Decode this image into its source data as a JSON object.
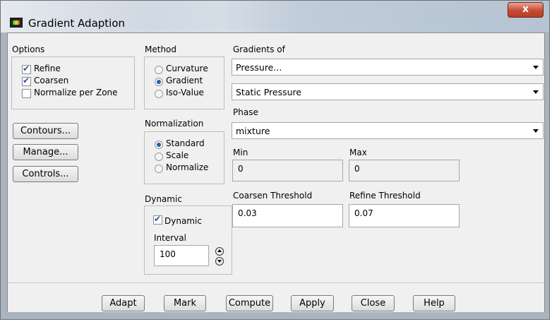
{
  "window": {
    "title": "Gradient Adaption",
    "close_glyph": "x"
  },
  "options": {
    "heading": "Options",
    "refine": {
      "label": "Refine",
      "checked": true
    },
    "coarsen": {
      "label": "Coarsen",
      "checked": true
    },
    "normalize_per_zone": {
      "label": "Normalize per Zone",
      "checked": false
    }
  },
  "side_buttons": {
    "contours": "Contours...",
    "manage": "Manage...",
    "controls": "Controls..."
  },
  "method": {
    "heading": "Method",
    "options": [
      "Curvature",
      "Gradient",
      "Iso-Value"
    ],
    "selected": "Gradient"
  },
  "normalization": {
    "heading": "Normalization",
    "options": [
      "Standard",
      "Scale",
      "Normalize"
    ],
    "selected": "Standard"
  },
  "dynamic": {
    "heading": "Dynamic",
    "checkbox_label": "Dynamic",
    "checked": true,
    "interval_label": "Interval",
    "interval_value": "100"
  },
  "gradients_of": {
    "heading": "Gradients of",
    "category": "Pressure...",
    "quantity": "Static Pressure"
  },
  "phase": {
    "heading": "Phase",
    "value": "mixture"
  },
  "range": {
    "min_label": "Min",
    "min_value": "0",
    "max_label": "Max",
    "max_value": "0"
  },
  "thresholds": {
    "coarsen_label": "Coarsen Threshold",
    "coarsen_value": "0.03",
    "refine_label": "Refine Threshold",
    "refine_value": "0.07"
  },
  "footer_buttons": {
    "adapt": "Adapt",
    "mark": "Mark",
    "compute": "Compute",
    "apply": "Apply",
    "close": "Close",
    "help": "Help"
  }
}
